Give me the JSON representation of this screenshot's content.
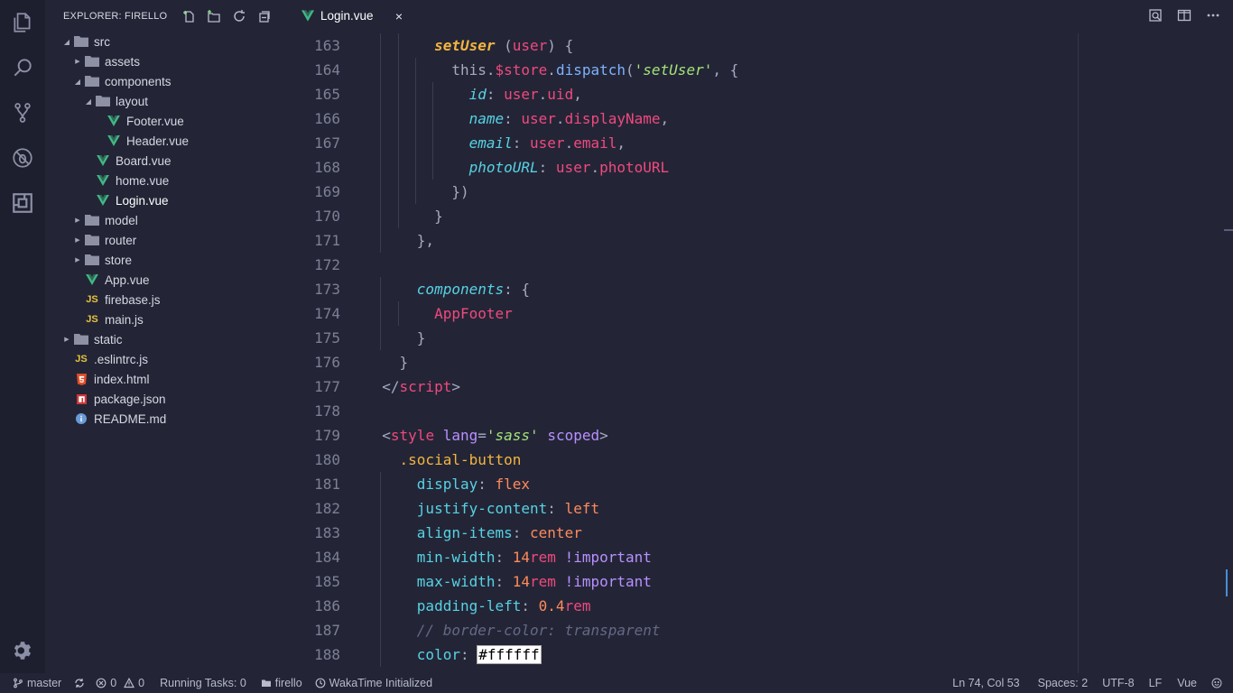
{
  "explorer": {
    "title": "EXPLORER: FIRELLO",
    "tree": [
      {
        "label": "src",
        "type": "folder",
        "depth": 0,
        "open": true
      },
      {
        "label": "assets",
        "type": "folder",
        "depth": 1,
        "open": false
      },
      {
        "label": "components",
        "type": "folder",
        "depth": 1,
        "open": true
      },
      {
        "label": "layout",
        "type": "folder",
        "depth": 2,
        "open": true
      },
      {
        "label": "Footer.vue",
        "type": "vue",
        "depth": 3
      },
      {
        "label": "Header.vue",
        "type": "vue",
        "depth": 3
      },
      {
        "label": "Board.vue",
        "type": "vue",
        "depth": 2
      },
      {
        "label": "home.vue",
        "type": "vue",
        "depth": 2
      },
      {
        "label": "Login.vue",
        "type": "vue",
        "depth": 2,
        "active": true
      },
      {
        "label": "model",
        "type": "folder",
        "depth": 1,
        "open": false
      },
      {
        "label": "router",
        "type": "folder",
        "depth": 1,
        "open": false
      },
      {
        "label": "store",
        "type": "folder",
        "depth": 1,
        "open": false
      },
      {
        "label": "App.vue",
        "type": "vue",
        "depth": 1
      },
      {
        "label": "firebase.js",
        "type": "js",
        "depth": 1
      },
      {
        "label": "main.js",
        "type": "js",
        "depth": 1
      },
      {
        "label": "static",
        "type": "folder",
        "depth": 0,
        "open": false
      },
      {
        "label": ".eslintrc.js",
        "type": "js",
        "depth": 0
      },
      {
        "label": "index.html",
        "type": "html",
        "depth": 0
      },
      {
        "label": "package.json",
        "type": "npm",
        "depth": 0
      },
      {
        "label": "README.md",
        "type": "info",
        "depth": 0
      }
    ]
  },
  "tab": {
    "label": "Login.vue",
    "close": "×"
  },
  "icons": {
    "activity": [
      "files-icon",
      "search-icon",
      "source-control-icon",
      "debug-icon",
      "extensions-icon"
    ],
    "settings": "gear-icon"
  },
  "code_lines": [
    {
      "n": "163",
      "indent": [
        1,
        2
      ],
      "tokens": [
        [
          "        ",
          "k-white"
        ],
        [
          "setUser",
          "k-yellowit"
        ],
        [
          " (",
          "k-gray"
        ],
        [
          "user",
          "k-pink"
        ],
        [
          ") {",
          "k-gray"
        ]
      ]
    },
    {
      "n": "164",
      "indent": [
        1,
        2,
        3
      ],
      "tokens": [
        [
          "          ",
          "k-white"
        ],
        [
          "this",
          "k-gray"
        ],
        [
          ".",
          "k-gray"
        ],
        [
          "$store",
          "k-pink"
        ],
        [
          ".",
          "k-gray"
        ],
        [
          "dispatch",
          "k-blue"
        ],
        [
          "(",
          "k-gray"
        ],
        [
          "'setUser'",
          "k-green"
        ],
        [
          ", {",
          "k-gray"
        ]
      ]
    },
    {
      "n": "165",
      "indent": [
        1,
        2,
        3,
        4
      ],
      "tokens": [
        [
          "            ",
          "k-white"
        ],
        [
          "id",
          "k-cyanit"
        ],
        [
          ": ",
          "k-gray"
        ],
        [
          "user",
          "k-pink"
        ],
        [
          ".",
          "k-gray"
        ],
        [
          "uid",
          "k-pink"
        ],
        [
          ",",
          "k-gray"
        ]
      ]
    },
    {
      "n": "166",
      "indent": [
        1,
        2,
        3,
        4
      ],
      "tokens": [
        [
          "            ",
          "k-white"
        ],
        [
          "name",
          "k-cyanit"
        ],
        [
          ": ",
          "k-gray"
        ],
        [
          "user",
          "k-pink"
        ],
        [
          ".",
          "k-gray"
        ],
        [
          "displayName",
          "k-pink"
        ],
        [
          ",",
          "k-gray"
        ]
      ]
    },
    {
      "n": "167",
      "indent": [
        1,
        2,
        3,
        4
      ],
      "tokens": [
        [
          "            ",
          "k-white"
        ],
        [
          "email",
          "k-cyanit"
        ],
        [
          ": ",
          "k-gray"
        ],
        [
          "user",
          "k-pink"
        ],
        [
          ".",
          "k-gray"
        ],
        [
          "email",
          "k-pink"
        ],
        [
          ",",
          "k-gray"
        ]
      ]
    },
    {
      "n": "168",
      "indent": [
        1,
        2,
        3,
        4
      ],
      "tokens": [
        [
          "            ",
          "k-white"
        ],
        [
          "photoURL",
          "k-cyanit"
        ],
        [
          ": ",
          "k-gray"
        ],
        [
          "user",
          "k-pink"
        ],
        [
          ".",
          "k-gray"
        ],
        [
          "photoURL",
          "k-pink"
        ]
      ]
    },
    {
      "n": "169",
      "indent": [
        1,
        2,
        3
      ],
      "tokens": [
        [
          "          ",
          "k-white"
        ],
        [
          "})",
          "k-gray"
        ]
      ]
    },
    {
      "n": "170",
      "indent": [
        1,
        2
      ],
      "tokens": [
        [
          "        ",
          "k-white"
        ],
        [
          "}",
          "k-gray"
        ]
      ]
    },
    {
      "n": "171",
      "indent": [
        1
      ],
      "tokens": [
        [
          "      ",
          "k-white"
        ],
        [
          "},",
          "k-gray"
        ]
      ]
    },
    {
      "n": "172",
      "indent": [],
      "tokens": []
    },
    {
      "n": "173",
      "indent": [
        1
      ],
      "tokens": [
        [
          "      ",
          "k-white"
        ],
        [
          "components",
          "k-cyanit"
        ],
        [
          ": {",
          "k-gray"
        ]
      ]
    },
    {
      "n": "174",
      "indent": [
        1,
        2
      ],
      "tokens": [
        [
          "        ",
          "k-white"
        ],
        [
          "AppFooter",
          "k-pink"
        ]
      ]
    },
    {
      "n": "175",
      "indent": [
        1
      ],
      "tokens": [
        [
          "      ",
          "k-white"
        ],
        [
          "}",
          "k-gray"
        ]
      ]
    },
    {
      "n": "176",
      "indent": [],
      "tokens": [
        [
          "    ",
          "k-white"
        ],
        [
          "}",
          "k-gray"
        ]
      ]
    },
    {
      "n": "177",
      "indent": [],
      "tokens": [
        [
          "  </",
          "k-gray"
        ],
        [
          "script",
          "k-pink"
        ],
        [
          ">",
          "k-gray"
        ]
      ]
    },
    {
      "n": "178",
      "indent": [],
      "tokens": []
    },
    {
      "n": "179",
      "indent": [],
      "tokens": [
        [
          "  <",
          "k-gray"
        ],
        [
          "style",
          "k-pink"
        ],
        [
          " ",
          "k-gray"
        ],
        [
          "lang",
          "k-purple"
        ],
        [
          "=",
          "k-gray"
        ],
        [
          "'sass'",
          "k-green"
        ],
        [
          " ",
          "k-gray"
        ],
        [
          "scoped",
          "k-purple"
        ],
        [
          ">",
          "k-gray"
        ]
      ]
    },
    {
      "n": "180",
      "indent": [],
      "tokens": [
        [
          "    ",
          "k-white"
        ],
        [
          ".social-button",
          "k-yellow"
        ]
      ]
    },
    {
      "n": "181",
      "indent": [
        1
      ],
      "tokens": [
        [
          "      ",
          "k-white"
        ],
        [
          "display",
          "k-cyan"
        ],
        [
          ": ",
          "k-gray"
        ],
        [
          "flex",
          "k-orange"
        ]
      ]
    },
    {
      "n": "182",
      "indent": [
        1
      ],
      "tokens": [
        [
          "      ",
          "k-white"
        ],
        [
          "justify-content",
          "k-cyan"
        ],
        [
          ": ",
          "k-gray"
        ],
        [
          "left",
          "k-orange"
        ]
      ]
    },
    {
      "n": "183",
      "indent": [
        1
      ],
      "tokens": [
        [
          "      ",
          "k-white"
        ],
        [
          "align-items",
          "k-cyan"
        ],
        [
          ": ",
          "k-gray"
        ],
        [
          "center",
          "k-orange"
        ]
      ]
    },
    {
      "n": "184",
      "indent": [
        1
      ],
      "tokens": [
        [
          "      ",
          "k-white"
        ],
        [
          "min-width",
          "k-cyan"
        ],
        [
          ": ",
          "k-gray"
        ],
        [
          "14",
          "k-orange"
        ],
        [
          "rem",
          "k-pink"
        ],
        [
          " !important",
          "k-purple"
        ]
      ]
    },
    {
      "n": "185",
      "indent": [
        1
      ],
      "tokens": [
        [
          "      ",
          "k-white"
        ],
        [
          "max-width",
          "k-cyan"
        ],
        [
          ": ",
          "k-gray"
        ],
        [
          "14",
          "k-orange"
        ],
        [
          "rem",
          "k-pink"
        ],
        [
          " !important",
          "k-purple"
        ]
      ]
    },
    {
      "n": "186",
      "indent": [
        1
      ],
      "tokens": [
        [
          "      ",
          "k-white"
        ],
        [
          "padding-left",
          "k-cyan"
        ],
        [
          ": ",
          "k-gray"
        ],
        [
          "0.4",
          "k-orange"
        ],
        [
          "rem",
          "k-pink"
        ]
      ]
    },
    {
      "n": "187",
      "indent": [
        1
      ],
      "tokens": [
        [
          "      ",
          "k-white"
        ],
        [
          "// border-color: transparent",
          "k-comment"
        ]
      ]
    },
    {
      "n": "188",
      "indent": [
        1
      ],
      "tokens": [
        [
          "      ",
          "k-white"
        ],
        [
          "color",
          "k-cyan"
        ],
        [
          ": ",
          "k-gray"
        ],
        [
          "#ffffff",
          "hexbox"
        ]
      ]
    }
  ],
  "statusbar": {
    "branch": "master",
    "errors": "0",
    "warnings": "0",
    "tasks": "Running Tasks: 0",
    "folder": "firello",
    "wakatime": "WakaTime Initialized",
    "position": "Ln 74, Col 53",
    "spaces": "Spaces: 2",
    "encoding": "UTF-8",
    "eol": "LF",
    "language": "Vue"
  },
  "colors": {
    "background": "#232536",
    "vue_green": "#41b883",
    "folder": "#8e91a3",
    "html": "#e44d26",
    "npm": "#cb3837",
    "info": "#6a9bd8",
    "js": "#e6c23f"
  }
}
